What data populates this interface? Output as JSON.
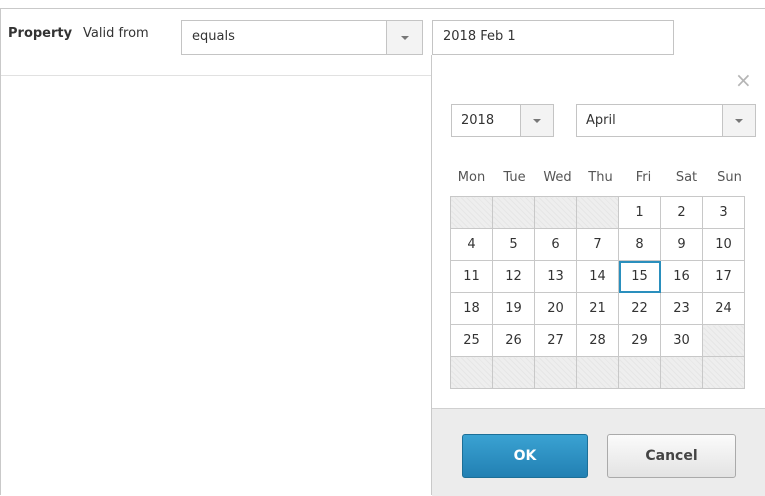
{
  "filter": {
    "property_label": "Property",
    "field_label": "Valid from",
    "operator_value": "equals",
    "date_value": "2018 Feb 1"
  },
  "picker": {
    "close_symbol": "×",
    "year": "2018",
    "month": "April",
    "weekdays": [
      "Mon",
      "Tue",
      "Wed",
      "Thu",
      "Fri",
      "Sat",
      "Sun"
    ],
    "weeks": [
      [
        "",
        "",
        "",
        "",
        "1",
        "2",
        "3"
      ],
      [
        "4",
        "5",
        "6",
        "7",
        "8",
        "9",
        "10"
      ],
      [
        "11",
        "12",
        "13",
        "14",
        "15",
        "16",
        "17"
      ],
      [
        "18",
        "19",
        "20",
        "21",
        "22",
        "23",
        "24"
      ],
      [
        "25",
        "26",
        "27",
        "28",
        "29",
        "30",
        ""
      ],
      [
        "",
        "",
        "",
        "",
        "",
        "",
        ""
      ]
    ],
    "selected_day": "15",
    "ok_label": "OK",
    "cancel_label": "Cancel"
  },
  "colors": {
    "accent": "#2a8fbd",
    "ok_button": "#2b8bc0"
  },
  "icons": {
    "dropdown": "chevron-down-icon",
    "close": "close-icon"
  }
}
